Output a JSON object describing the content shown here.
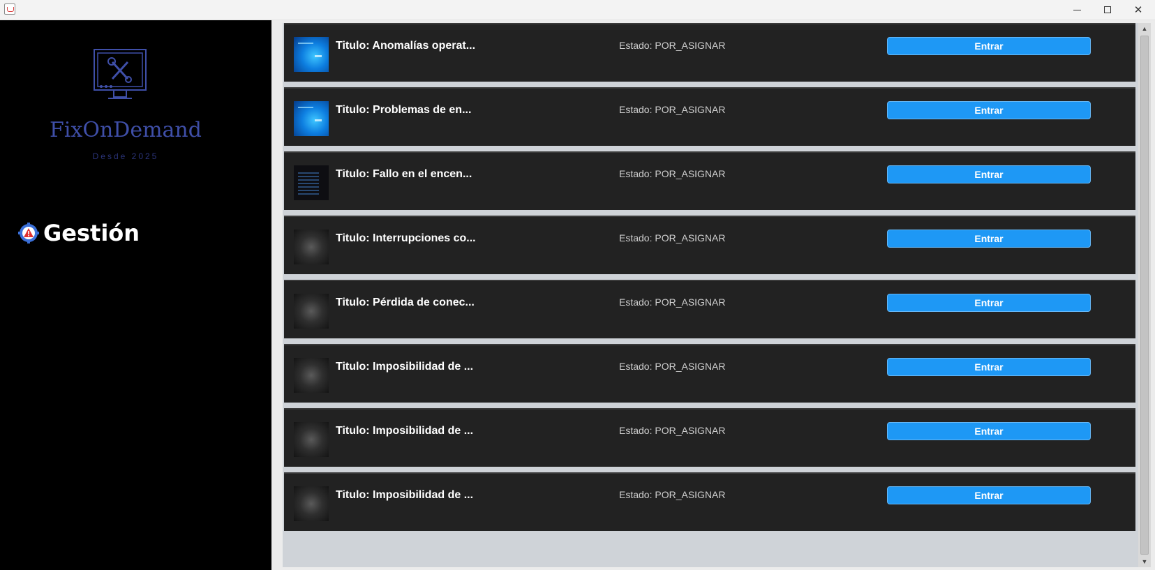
{
  "window": {
    "minimize_icon": "minimize-icon",
    "maximize_icon": "maximize-icon",
    "close_icon": "close-icon",
    "close_glyph": "✕"
  },
  "sidebar": {
    "brand": "FixOnDemand",
    "tagline": "Desde 2025",
    "nav_label": "Gestión",
    "colors": {
      "background": "#000000",
      "brand": "#3f4fa8",
      "nav_text": "#ffffff"
    }
  },
  "tickets": [
    {
      "title": "Titulo: Anomalías operat...",
      "status": "Estado: POR_ASIGNAR",
      "button": "Entrar",
      "thumb": "thumb-blue"
    },
    {
      "title": "Titulo: Problemas de en...",
      "status": "Estado: POR_ASIGNAR",
      "button": "Entrar",
      "thumb": "thumb-blue"
    },
    {
      "title": "Titulo: Fallo en el encen...",
      "status": "Estado: POR_ASIGNAR",
      "button": "Entrar",
      "thumb": "thumb-code"
    },
    {
      "title": "Titulo: Interrupciones co...",
      "status": "Estado: POR_ASIGNAR",
      "button": "Entrar",
      "thumb": "thumb-dark"
    },
    {
      "title": "Titulo: Pérdida de conec...",
      "status": "Estado: POR_ASIGNAR",
      "button": "Entrar",
      "thumb": "thumb-dark"
    },
    {
      "title": "Titulo: Imposibilidad de ...",
      "status": "Estado: POR_ASIGNAR",
      "button": "Entrar",
      "thumb": "thumb-dark"
    },
    {
      "title": "Titulo: Imposibilidad de ...",
      "status": "Estado: POR_ASIGNAR",
      "button": "Entrar",
      "thumb": "thumb-dark"
    },
    {
      "title": "Titulo: Imposibilidad de ...",
      "status": "Estado: POR_ASIGNAR",
      "button": "Entrar",
      "thumb": "thumb-dark"
    }
  ],
  "colors": {
    "row_background": "#222222",
    "button": "#1e98f5",
    "list_gap": "#cfd3d8"
  }
}
